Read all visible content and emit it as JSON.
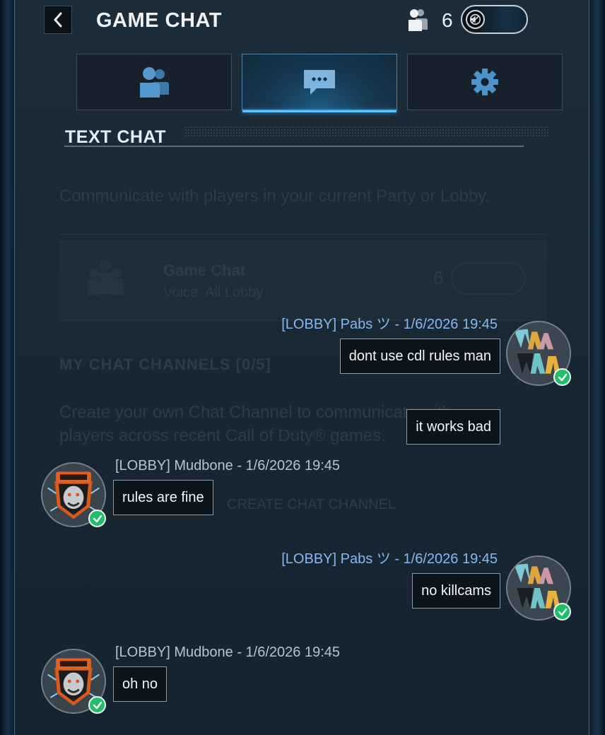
{
  "header": {
    "title": "GAME CHAT",
    "player_count": "6"
  },
  "tabs": [
    {
      "icon": "party-icon"
    },
    {
      "icon": "chat-bubble-icon",
      "selected": true
    },
    {
      "icon": "gear-icon"
    }
  ],
  "section": {
    "title": "TEXT CHAT"
  },
  "background_panel": {
    "description": "Communicate with players in your current Party or Lobby.",
    "card_title": "Game Chat",
    "card_subtitle": "Voice: All Lobby",
    "card_count": "6",
    "channels_heading": "MY CHAT CHANNELS [0/5]",
    "create_text_line1": "Create your own Chat Channel to communicate with",
    "create_text_line2": "players across recent Call of Duty® games.",
    "create_button": "CREATE CHAT CHANNEL"
  },
  "messages": [
    {
      "header": "[LOBBY] Pabs ツ - 1/6/2026 19:45",
      "text": "dont use cdl rules man",
      "side": "self"
    },
    {
      "text": "it works bad",
      "side": "self"
    },
    {
      "header": "[LOBBY] Mudbone - 1/6/2026 19:45",
      "text": "rules are fine",
      "side": "other"
    },
    {
      "header": "[LOBBY] Pabs ツ - 1/6/2026 19:45",
      "text": "no killcams",
      "side": "self"
    },
    {
      "header": "[LOBBY] Mudbone - 1/6/2026 19:45",
      "text": "oh no",
      "side": "other"
    }
  ],
  "colors": {
    "accent": "#5cc3ff",
    "self_name": "#86b8f2",
    "other_name": "#b9c2c9",
    "verified": "#1fbf68"
  }
}
